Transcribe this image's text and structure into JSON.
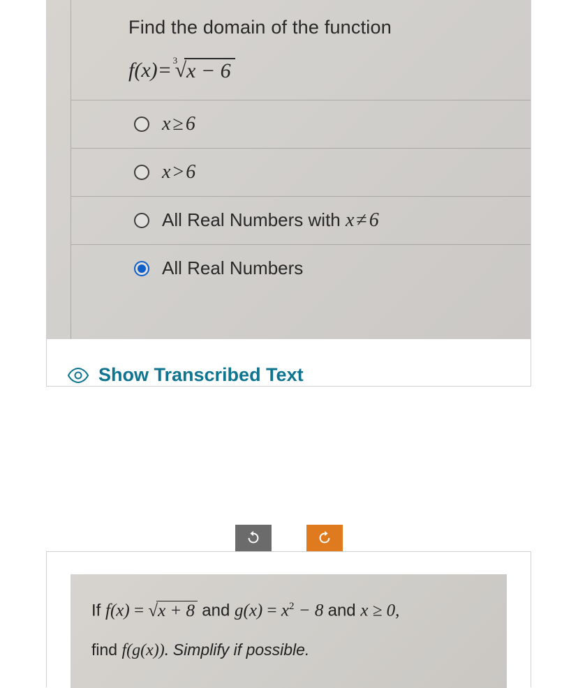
{
  "question1": {
    "prompt": "Find the domain of the function",
    "formula": {
      "fx": "f(x)",
      "eq": "=",
      "root_index": "3",
      "radicand": "x − 6"
    },
    "options": [
      {
        "html": "<span class='math-inline'>x<span class='sym'>≥</span>6</span>",
        "selected": false
      },
      {
        "html": "<span class='math-inline'>x<span class='sym'>&gt;</span>6</span>",
        "selected": false
      },
      {
        "html": "<span style='font-family:Arial'>All Real Numbers with&nbsp;</span><span class='math-inline'>x<span class='sym'>≠</span>6</span>",
        "selected": false
      },
      {
        "html": "<span style='font-family:Arial'>All Real Numbers</span>",
        "selected": true
      }
    ]
  },
  "show_link": "Show Transcribed Text",
  "question2": {
    "line1_prefix": "If ",
    "fx": "f(x)",
    "eq": "=",
    "sqrt_radicand": "x + 8",
    "and1": " and ",
    "gx": "g(x)",
    "gx_rhs_a": "x",
    "gx_rhs_exp": "2",
    "gx_rhs_b": " − 8",
    "and2": " and ",
    "cond": "x ≥ 0,",
    "line2_prefix": "find ",
    "fgx": "f(g(x)).",
    "line2_suffix": " Simplify if possible."
  }
}
